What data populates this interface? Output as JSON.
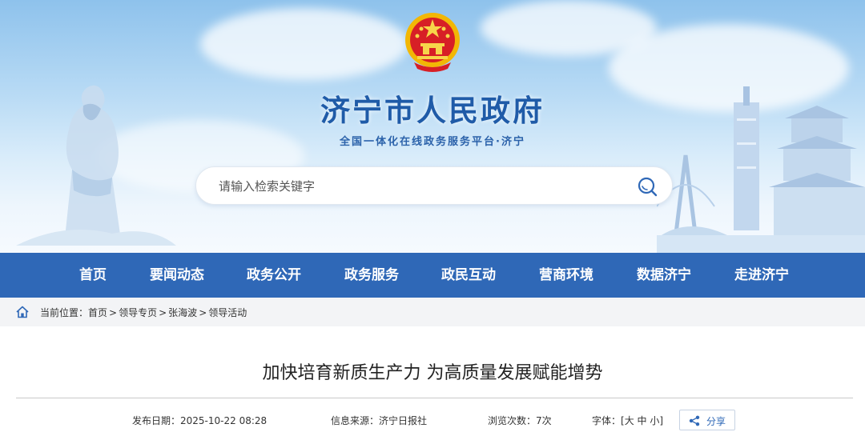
{
  "header": {
    "site_title": "济宁市人民政府",
    "site_subtitle": "全国一体化在线政务服务平台·济宁",
    "emblem": "national-emblem"
  },
  "search": {
    "placeholder": "请输入检索关键字",
    "value": "",
    "icon": "search-icon"
  },
  "nav": {
    "items": [
      {
        "label": "首页"
      },
      {
        "label": "要闻动态"
      },
      {
        "label": "政务公开"
      },
      {
        "label": "政务服务"
      },
      {
        "label": "政民互动"
      },
      {
        "label": "营商环境"
      },
      {
        "label": "数据济宁"
      },
      {
        "label": "走进济宁"
      }
    ]
  },
  "breadcrumb": {
    "prefix": "当前位置：",
    "items": [
      "首页",
      "领导专页",
      "张海波",
      "领导活动"
    ],
    "separator": ">"
  },
  "article": {
    "title": "加快培育新质生产力 为高质量发展赋能增势",
    "publish_label": "发布日期：",
    "publish_date": "2025-10-22 08:28",
    "source_label": "信息来源：",
    "source": "济宁日报社",
    "views_label": "浏览次数：",
    "views": "7次",
    "font_label": "字体：",
    "font_open": "[",
    "font_large": "大",
    "font_medium": "中",
    "font_small": "小",
    "font_close": "]",
    "share_label": "分享"
  },
  "colors": {
    "nav_bg": "#2f68b7",
    "title_blue": "#1f5ba8",
    "breadcrumb_bg": "#f3f4f6"
  }
}
